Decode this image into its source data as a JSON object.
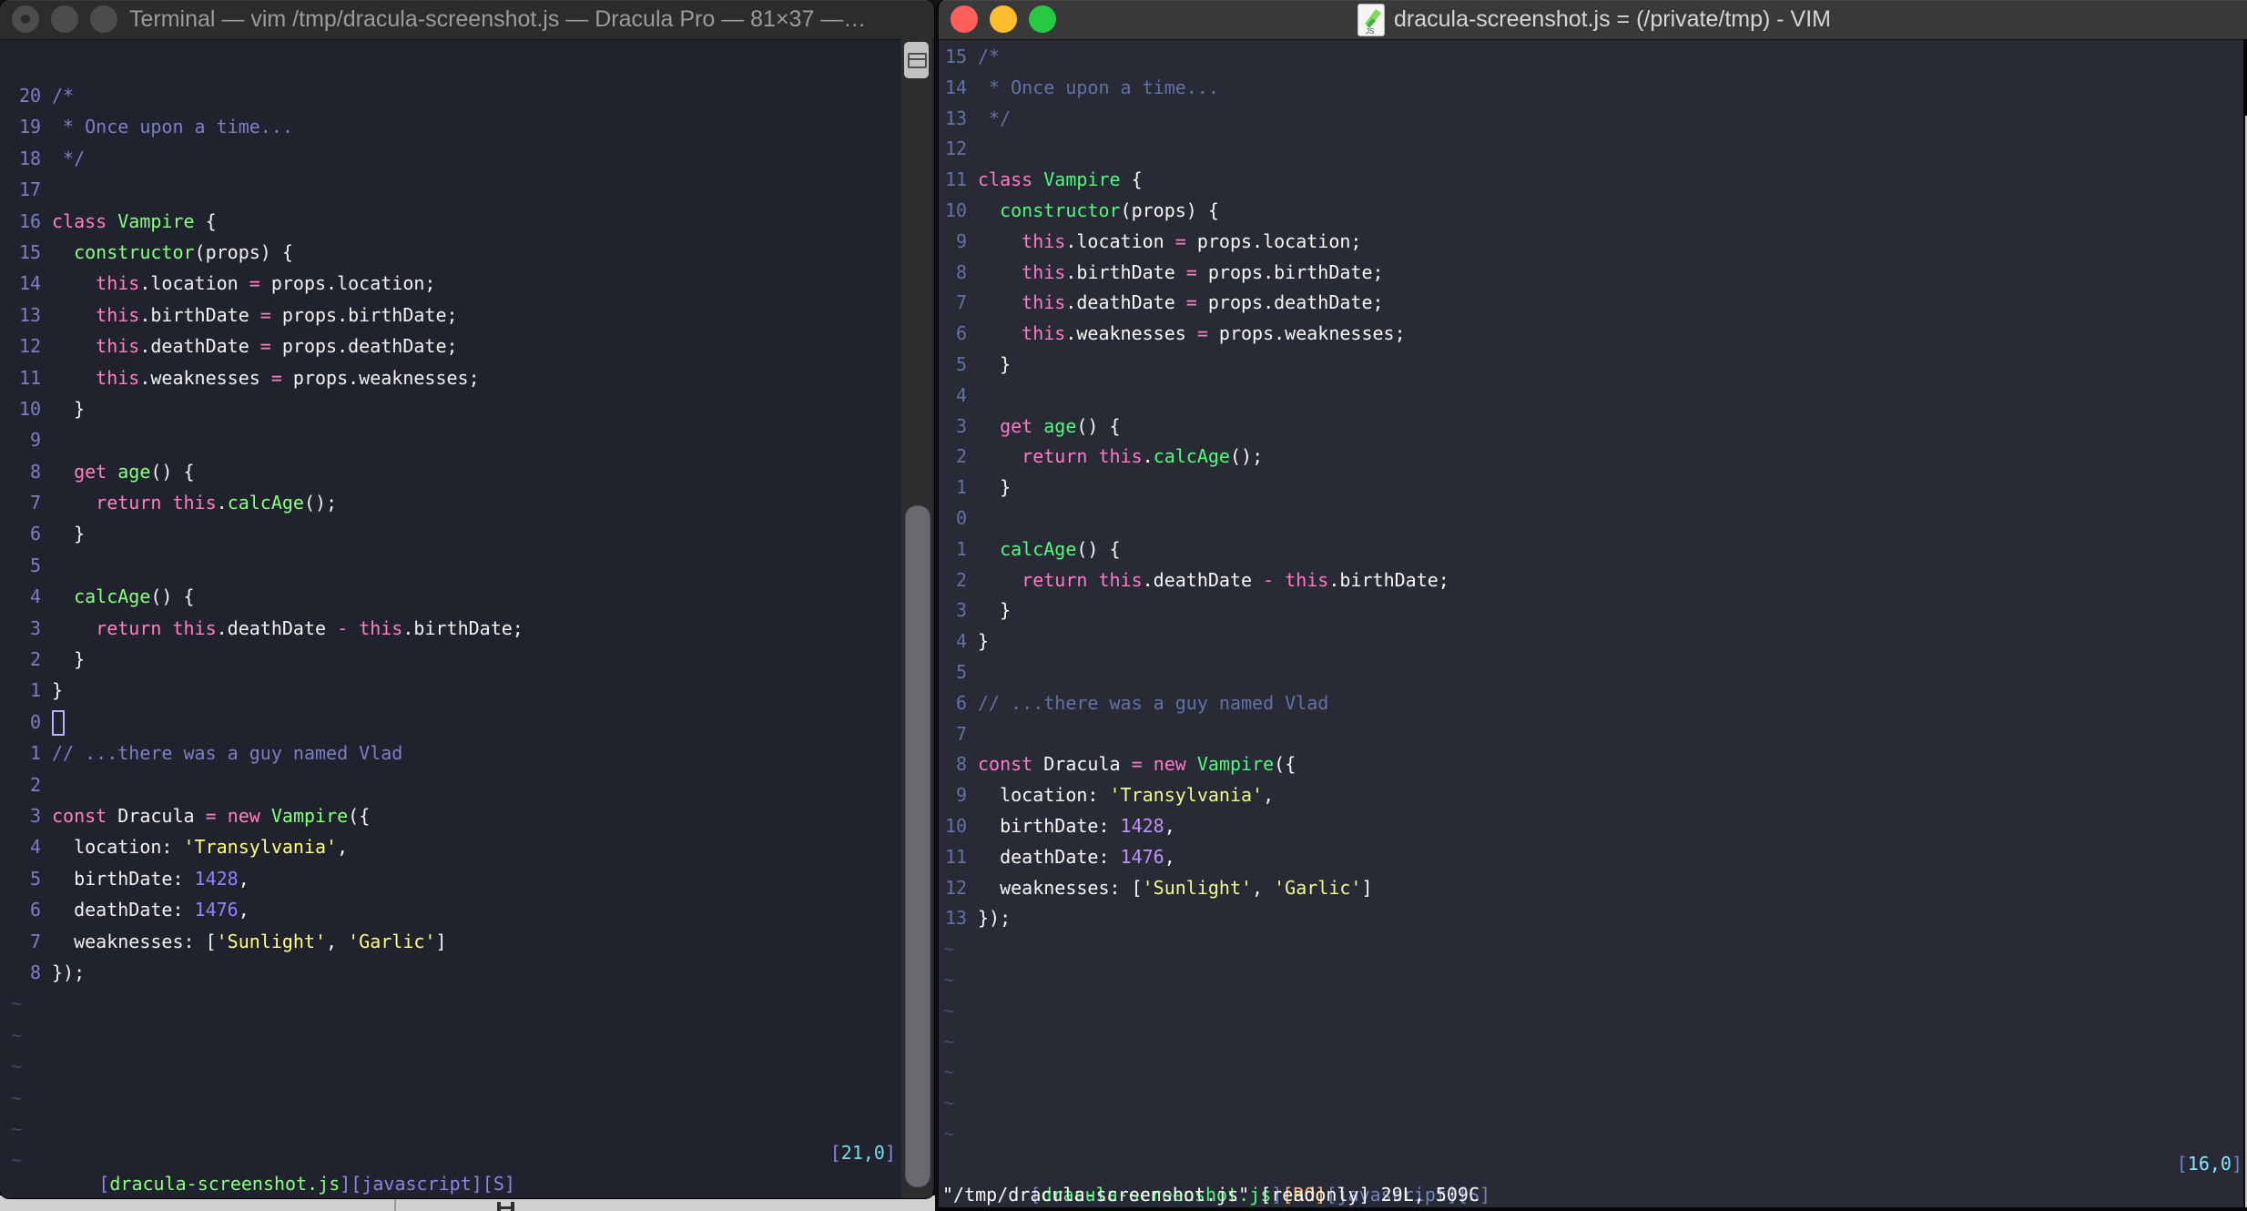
{
  "palette": {
    "ui": {
      "screen_bg": "#141414",
      "titlebar_inactive": "#2b2c2e",
      "titlebar_active": "#39393b",
      "title_text_inactive": "#9b9b9b",
      "title_text_active": "#d6d6d6",
      "light_inactive": "#4c4c4e",
      "light_red": "#ff5f58",
      "light_yellow": "#febc2e",
      "light_green": "#28c840",
      "scroll_track": "#2d2d2f",
      "scroll_thumb": "#6a6a6e",
      "split_button": "#c2c2c4",
      "desktop_strip": "#d1d1d1",
      "edge_scrollbar_sliver": "#c4c4c6"
    },
    "left": {
      "bg": "#20222e",
      "fg": "#f2f2ee",
      "comment": "#7b7fc4",
      "linenr": "#7b7fc4",
      "pink": "#ff80bf",
      "green": "#8aff80",
      "yellow": "#ffff80",
      "purple": "#9580ff",
      "cyan": "#7adce8",
      "bracket": "#8d85df",
      "tilde": "#43465c",
      "cursor_outline": "#b9b3ff"
    },
    "right": {
      "bg": "#282a36",
      "fg": "#f8f8f2",
      "comment": "#6272a4",
      "linenr": "#6272a4",
      "pink": "#ff79c6",
      "green": "#50fa7b",
      "yellow": "#f1fa8c",
      "purple": "#bd93f9",
      "cyan": "#8be9fd",
      "orange": "#ffb86c",
      "bracket": "#6f83c0",
      "tilde": "#474e6d"
    }
  },
  "left_window": {
    "titlebar": {
      "title": "Terminal — vim /tmp/dracula-screenshot.js — Dracula Pro — 81×37 —…"
    },
    "tilde": "~",
    "tilde_count": 6,
    "lines": [
      {
        "n": "20",
        "s": [
          [
            "cm",
            "/*"
          ]
        ]
      },
      {
        "n": "19",
        "s": [
          [
            "cm",
            " * Once upon a time..."
          ]
        ]
      },
      {
        "n": "18",
        "s": [
          [
            "cm",
            " */"
          ]
        ]
      },
      {
        "n": "17",
        "s": []
      },
      {
        "n": "16",
        "s": [
          [
            "pk",
            "class"
          ],
          [
            "fg",
            " "
          ],
          [
            "gr",
            "Vampire"
          ],
          [
            "fg",
            " {"
          ]
        ]
      },
      {
        "n": "15",
        "s": [
          [
            "fg",
            "  "
          ],
          [
            "gr",
            "constructor"
          ],
          [
            "fg",
            "(props) {"
          ]
        ]
      },
      {
        "n": "14",
        "s": [
          [
            "fg",
            "    "
          ],
          [
            "pk",
            "this"
          ],
          [
            "fg",
            ".location "
          ],
          [
            "pk",
            "="
          ],
          [
            "fg",
            " props.location;"
          ]
        ]
      },
      {
        "n": "13",
        "s": [
          [
            "fg",
            "    "
          ],
          [
            "pk",
            "this"
          ],
          [
            "fg",
            ".birthDate "
          ],
          [
            "pk",
            "="
          ],
          [
            "fg",
            " props.birthDate;"
          ]
        ]
      },
      {
        "n": "12",
        "s": [
          [
            "fg",
            "    "
          ],
          [
            "pk",
            "this"
          ],
          [
            "fg",
            ".deathDate "
          ],
          [
            "pk",
            "="
          ],
          [
            "fg",
            " props.deathDate;"
          ]
        ]
      },
      {
        "n": "11",
        "s": [
          [
            "fg",
            "    "
          ],
          [
            "pk",
            "this"
          ],
          [
            "fg",
            ".weaknesses "
          ],
          [
            "pk",
            "="
          ],
          [
            "fg",
            " props.weaknesses;"
          ]
        ]
      },
      {
        "n": "10",
        "s": [
          [
            "fg",
            "  }"
          ]
        ]
      },
      {
        "n": "9",
        "s": []
      },
      {
        "n": "8",
        "s": [
          [
            "fg",
            "  "
          ],
          [
            "pk",
            "get"
          ],
          [
            "fg",
            " "
          ],
          [
            "gr",
            "age"
          ],
          [
            "fg",
            "() {"
          ]
        ]
      },
      {
        "n": "7",
        "s": [
          [
            "fg",
            "    "
          ],
          [
            "pk",
            "return"
          ],
          [
            "fg",
            " "
          ],
          [
            "pk",
            "this"
          ],
          [
            "fg",
            "."
          ],
          [
            "gr",
            "calcAge"
          ],
          [
            "fg",
            "();"
          ]
        ]
      },
      {
        "n": "6",
        "s": [
          [
            "fg",
            "  }"
          ]
        ]
      },
      {
        "n": "5",
        "s": []
      },
      {
        "n": "4",
        "s": [
          [
            "fg",
            "  "
          ],
          [
            "gr",
            "calcAge"
          ],
          [
            "fg",
            "() {"
          ]
        ]
      },
      {
        "n": "3",
        "s": [
          [
            "fg",
            "    "
          ],
          [
            "pk",
            "return"
          ],
          [
            "fg",
            " "
          ],
          [
            "pk",
            "this"
          ],
          [
            "fg",
            ".deathDate "
          ],
          [
            "pk",
            "-"
          ],
          [
            "fg",
            " "
          ],
          [
            "pk",
            "this"
          ],
          [
            "fg",
            ".birthDate;"
          ]
        ]
      },
      {
        "n": "2",
        "s": [
          [
            "fg",
            "  }"
          ]
        ]
      },
      {
        "n": "1",
        "s": [
          [
            "fg",
            "}"
          ]
        ]
      },
      {
        "n": "0",
        "s": [],
        "cursor": true
      },
      {
        "n": "1",
        "s": [
          [
            "cm",
            "// ...there was a guy named Vlad"
          ]
        ]
      },
      {
        "n": "2",
        "s": []
      },
      {
        "n": "3",
        "s": [
          [
            "pk",
            "const"
          ],
          [
            "fg",
            " Dracula "
          ],
          [
            "pk",
            "="
          ],
          [
            "fg",
            " "
          ],
          [
            "pk",
            "new"
          ],
          [
            "fg",
            " "
          ],
          [
            "gr",
            "Vampire"
          ],
          [
            "fg",
            "({"
          ]
        ]
      },
      {
        "n": "4",
        "s": [
          [
            "fg",
            "  location: "
          ],
          [
            "yl",
            "'Transylvania'"
          ],
          [
            "fg",
            ","
          ]
        ]
      },
      {
        "n": "5",
        "s": [
          [
            "fg",
            "  birthDate: "
          ],
          [
            "pu",
            "1428"
          ],
          [
            "fg",
            ","
          ]
        ]
      },
      {
        "n": "6",
        "s": [
          [
            "fg",
            "  deathDate: "
          ],
          [
            "pu",
            "1476"
          ],
          [
            "fg",
            ","
          ]
        ]
      },
      {
        "n": "7",
        "s": [
          [
            "fg",
            "  weaknesses: ["
          ],
          [
            "yl",
            "'Sunlight'"
          ],
          [
            "fg",
            ", "
          ],
          [
            "yl",
            "'Garlic'"
          ],
          [
            "fg",
            "]"
          ]
        ]
      },
      {
        "n": "8",
        "s": [
          [
            "fg",
            "});"
          ]
        ]
      }
    ],
    "status": {
      "left": [
        [
          "br",
          "["
        ],
        [
          "gr",
          "dracula-screenshot.js"
        ],
        [
          "br",
          "][javascript][S]"
        ]
      ],
      "right": [
        [
          "br",
          "["
        ],
        [
          "cy",
          "21,0"
        ],
        [
          "br",
          "]"
        ]
      ]
    }
  },
  "right_window": {
    "titlebar": {
      "title": "dracula-screenshot.js = (/private/tmp) - VIM",
      "icon": "js-document-icon"
    },
    "tilde": "~",
    "tilde_count": 7,
    "lines": [
      {
        "n": "15",
        "s": [
          [
            "cm",
            "/*"
          ]
        ]
      },
      {
        "n": "14",
        "s": [
          [
            "cm",
            " * Once upon a time..."
          ]
        ]
      },
      {
        "n": "13",
        "s": [
          [
            "cm",
            " */"
          ]
        ]
      },
      {
        "n": "12",
        "s": []
      },
      {
        "n": "11",
        "s": [
          [
            "pk",
            "class"
          ],
          [
            "fg",
            " "
          ],
          [
            "gr",
            "Vampire"
          ],
          [
            "fg",
            " {"
          ]
        ]
      },
      {
        "n": "10",
        "s": [
          [
            "fg",
            "  "
          ],
          [
            "gr",
            "constructor"
          ],
          [
            "fg",
            "(props) {"
          ]
        ]
      },
      {
        "n": "9",
        "s": [
          [
            "fg",
            "    "
          ],
          [
            "pk",
            "this"
          ],
          [
            "fg",
            ".location "
          ],
          [
            "pk",
            "="
          ],
          [
            "fg",
            " props.location;"
          ]
        ]
      },
      {
        "n": "8",
        "s": [
          [
            "fg",
            "    "
          ],
          [
            "pk",
            "this"
          ],
          [
            "fg",
            ".birthDate "
          ],
          [
            "pk",
            "="
          ],
          [
            "fg",
            " props.birthDate;"
          ]
        ]
      },
      {
        "n": "7",
        "s": [
          [
            "fg",
            "    "
          ],
          [
            "pk",
            "this"
          ],
          [
            "fg",
            ".deathDate "
          ],
          [
            "pk",
            "="
          ],
          [
            "fg",
            " props.deathDate;"
          ]
        ]
      },
      {
        "n": "6",
        "s": [
          [
            "fg",
            "    "
          ],
          [
            "pk",
            "this"
          ],
          [
            "fg",
            ".weaknesses "
          ],
          [
            "pk",
            "="
          ],
          [
            "fg",
            " props.weaknesses;"
          ]
        ]
      },
      {
        "n": "5",
        "s": [
          [
            "fg",
            "  }"
          ]
        ]
      },
      {
        "n": "4",
        "s": []
      },
      {
        "n": "3",
        "s": [
          [
            "fg",
            "  "
          ],
          [
            "pk",
            "get"
          ],
          [
            "fg",
            " "
          ],
          [
            "gr",
            "age"
          ],
          [
            "fg",
            "() {"
          ]
        ]
      },
      {
        "n": "2",
        "s": [
          [
            "fg",
            "    "
          ],
          [
            "pk",
            "return"
          ],
          [
            "fg",
            " "
          ],
          [
            "pk",
            "this"
          ],
          [
            "fg",
            "."
          ],
          [
            "gr",
            "calcAge"
          ],
          [
            "fg",
            "();"
          ]
        ]
      },
      {
        "n": "1",
        "s": [
          [
            "fg",
            "  }"
          ]
        ]
      },
      {
        "n": "0",
        "s": []
      },
      {
        "n": "1",
        "s": [
          [
            "fg",
            "  "
          ],
          [
            "gr",
            "calcAge"
          ],
          [
            "fg",
            "() {"
          ]
        ]
      },
      {
        "n": "2",
        "s": [
          [
            "fg",
            "    "
          ],
          [
            "pk",
            "return"
          ],
          [
            "fg",
            " "
          ],
          [
            "pk",
            "this"
          ],
          [
            "fg",
            ".deathDate "
          ],
          [
            "pk",
            "-"
          ],
          [
            "fg",
            " "
          ],
          [
            "pk",
            "this"
          ],
          [
            "fg",
            ".birthDate;"
          ]
        ]
      },
      {
        "n": "3",
        "s": [
          [
            "fg",
            "  }"
          ]
        ]
      },
      {
        "n": "4",
        "s": [
          [
            "fg",
            "}"
          ]
        ]
      },
      {
        "n": "5",
        "s": []
      },
      {
        "n": "6",
        "s": [
          [
            "cm",
            "// ...there was a guy named Vlad"
          ]
        ]
      },
      {
        "n": "7",
        "s": []
      },
      {
        "n": "8",
        "s": [
          [
            "pk",
            "const"
          ],
          [
            "fg",
            " Dracula "
          ],
          [
            "pk",
            "="
          ],
          [
            "fg",
            " "
          ],
          [
            "pk",
            "new"
          ],
          [
            "fg",
            " "
          ],
          [
            "gr",
            "Vampire"
          ],
          [
            "fg",
            "({"
          ]
        ]
      },
      {
        "n": "9",
        "s": [
          [
            "fg",
            "  location: "
          ],
          [
            "yl",
            "'Transylvania'"
          ],
          [
            "fg",
            ","
          ]
        ]
      },
      {
        "n": "10",
        "s": [
          [
            "fg",
            "  birthDate: "
          ],
          [
            "pu",
            "1428"
          ],
          [
            "fg",
            ","
          ]
        ]
      },
      {
        "n": "11",
        "s": [
          [
            "fg",
            "  deathDate: "
          ],
          [
            "pu",
            "1476"
          ],
          [
            "fg",
            ","
          ]
        ]
      },
      {
        "n": "12",
        "s": [
          [
            "fg",
            "  weaknesses: ["
          ],
          [
            "yl",
            "'Sunlight'"
          ],
          [
            "fg",
            ", "
          ],
          [
            "yl",
            "'Garlic'"
          ],
          [
            "fg",
            "]"
          ]
        ]
      },
      {
        "n": "13",
        "s": [
          [
            "fg",
            "});"
          ]
        ]
      }
    ],
    "status": {
      "left": [
        [
          "br",
          "["
        ],
        [
          "gr",
          "dracula-screenshot.js"
        ],
        [
          "br",
          "]"
        ],
        [
          "or",
          "[RO]"
        ],
        [
          "br",
          "[javascript][S]"
        ]
      ],
      "right": [
        [
          "br",
          "["
        ],
        [
          "cy",
          "16,0"
        ],
        [
          "br",
          "]"
        ]
      ]
    },
    "command_line": "\"/tmp/dracula-screenshot.js\" [readonly] 29L, 509C"
  }
}
